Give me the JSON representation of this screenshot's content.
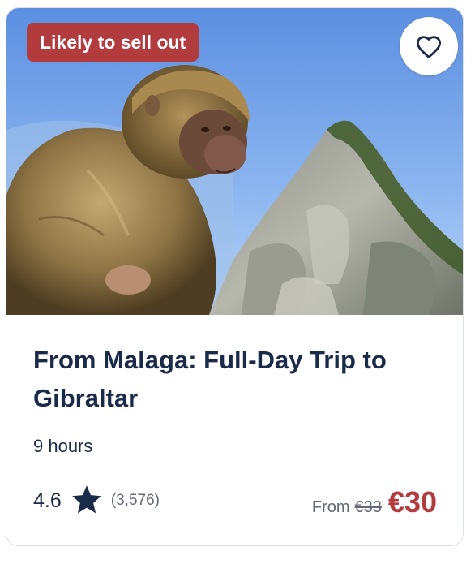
{
  "badge": {
    "label": "Likely to sell out",
    "color": "#b23b3e"
  },
  "favorite": {
    "icon": "heart-outline-icon"
  },
  "image": {
    "subject": "Barbary macaque in front of the Rock of Gibraltar"
  },
  "title": "From Malaga: Full-Day Trip to Gibraltar",
  "duration": "9 hours",
  "rating": {
    "value": "4.6",
    "icon": "star-icon",
    "reviews": "(3,576)"
  },
  "price": {
    "from_label": "From",
    "original": "€33",
    "current": "€30",
    "accent": "#b23b3e"
  },
  "colors": {
    "text": "#1a2b49",
    "muted": "#63687a"
  }
}
